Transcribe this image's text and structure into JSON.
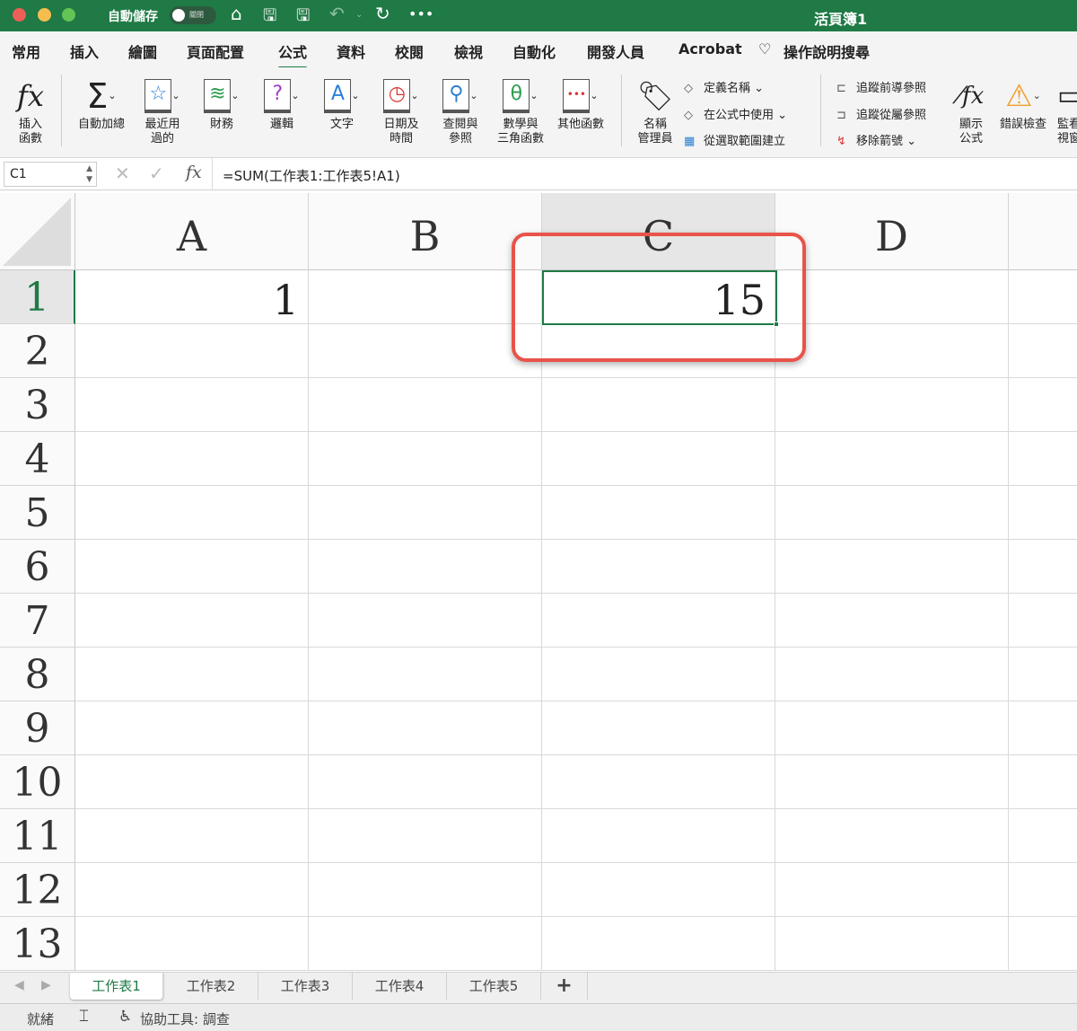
{
  "titlebar": {
    "autosave_label": "自動儲存",
    "autosave_state": "關閉",
    "title": "活頁簿1",
    "icons": [
      "home-icon",
      "save-icon",
      "save-as-icon",
      "undo-icon",
      "redo-icon",
      "more-icon"
    ]
  },
  "tabs": [
    "常用",
    "插入",
    "繪圖",
    "頁面配置",
    "公式",
    "資料",
    "校閱",
    "檢視",
    "自動化",
    "開發人員",
    "Acrobat"
  ],
  "active_tab": "公式",
  "search_label": "操作說明搜尋",
  "ribbon": {
    "insert_function": "插入\n函數",
    "buttons": [
      {
        "label": "自動加總",
        "icon": "Σ"
      },
      {
        "label": "最近用\n過的",
        "icon": "☆"
      },
      {
        "label": "財務",
        "icon": "≋"
      },
      {
        "label": "邏輯",
        "icon": "?"
      },
      {
        "label": "文字",
        "icon": "A"
      },
      {
        "label": "日期及\n時間",
        "icon": "◷"
      },
      {
        "label": "查閱與\n參照",
        "icon": "⚲"
      },
      {
        "label": "數學與\n三角函數",
        "icon": "θ"
      },
      {
        "label": "其他函數",
        "icon": "•••"
      }
    ],
    "name_manager": "名稱\n管理員",
    "define_name": "定義名稱",
    "use_in_formula": "在公式中使用",
    "create_from_selection": "從選取範圍建立",
    "trace_precedents": "追蹤前導參照",
    "trace_dependents": "追蹤從屬參照",
    "remove_arrows": "移除箭號",
    "show_formulas": "顯示\n公式",
    "error_checking": "錯誤檢查",
    "watch_window": "監看\n視窗"
  },
  "formula_bar": {
    "name_box": "C1",
    "formula": "=SUM(工作表1:工作表5!A1)",
    "fx": "fx"
  },
  "grid": {
    "columns": [
      "A",
      "B",
      "C",
      "D"
    ],
    "rows": [
      "1",
      "2",
      "3",
      "4",
      "5",
      "6",
      "7",
      "8",
      "9",
      "10",
      "11",
      "12",
      "13"
    ],
    "cells": {
      "A1": "1",
      "C1": "15"
    },
    "selected": "C1",
    "highlight_color": "#e8534a",
    "accent": "#1f7a45"
  },
  "sheets": [
    "工作表1",
    "工作表2",
    "工作表3",
    "工作表4",
    "工作表5"
  ],
  "active_sheet": "工作表1",
  "add_sheet": "+",
  "status": {
    "ready": "就緒",
    "accessibility": "協助工具: 調查"
  }
}
